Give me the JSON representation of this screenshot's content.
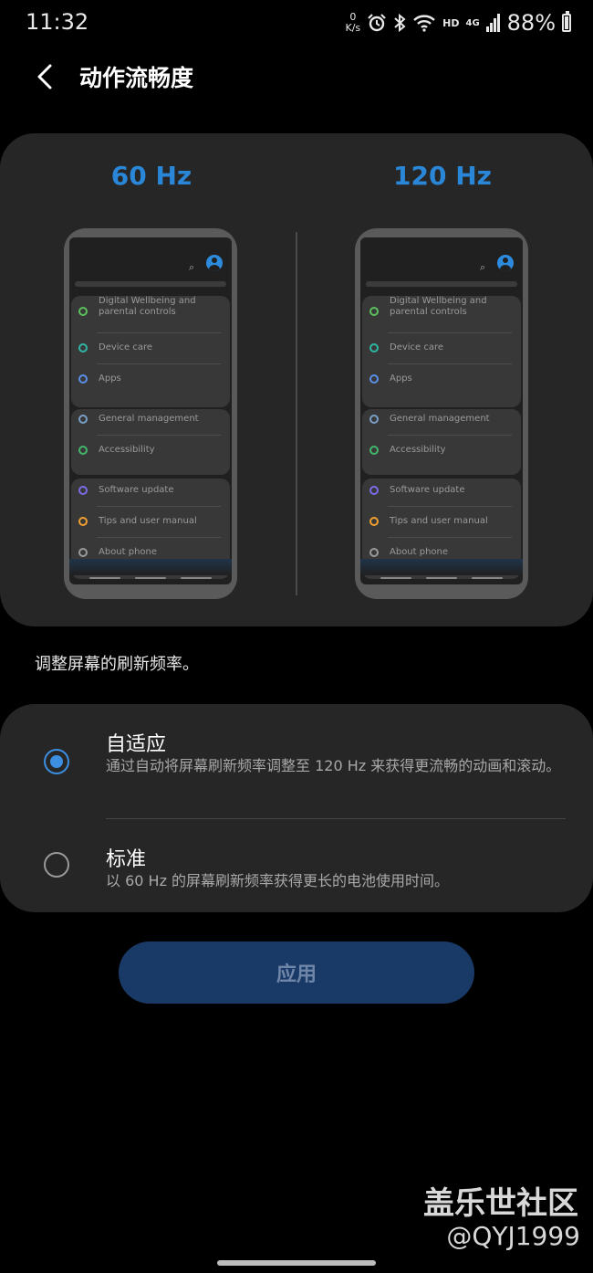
{
  "status": {
    "time": "11:32",
    "net_speed_value": "0",
    "net_speed_unit": "K/s",
    "hd": "HD",
    "network": "4G",
    "battery": "88%"
  },
  "header": {
    "title": "动作流畅度"
  },
  "preview": {
    "left_hz": "60 Hz",
    "right_hz": "120 Hz",
    "phone_items": [
      "Digital Wellbeing and parental controls",
      "Device care",
      "Apps",
      "General management",
      "Accessibility",
      "Software update",
      "Tips and user manual",
      "About phone"
    ],
    "icon_colors": [
      "#5cc15c",
      "#2fb7a5",
      "#5b8fe8",
      "#7aa0c8",
      "#43b66b",
      "#7b6de8",
      "#f0a030",
      "#9a9a9a"
    ]
  },
  "description": "调整屏幕的刷新频率。",
  "options": [
    {
      "title": "自适应",
      "desc": "通过自动将屏幕刷新频率调整至 120 Hz 来获得更流畅的动画和滚动。",
      "selected": true
    },
    {
      "title": "标准",
      "desc": "以 60 Hz 的屏幕刷新频率获得更长的电池使用时间。",
      "selected": false
    }
  ],
  "apply_label": "应用",
  "watermark": {
    "line1": "盖乐世社区",
    "line2": "@QYJ1999"
  },
  "colors": {
    "accent": "#3c8ee0",
    "hz_blue": "#2a86d6",
    "card": "#262626",
    "button": "#193a66"
  }
}
